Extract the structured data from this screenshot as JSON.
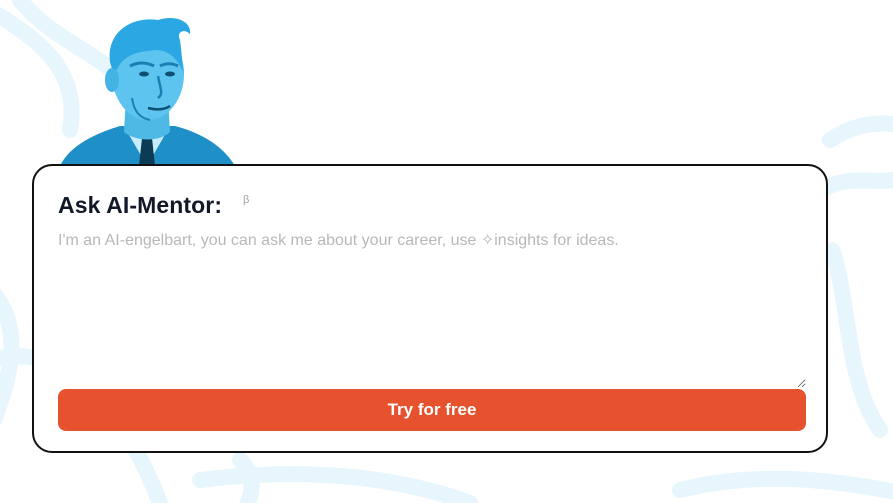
{
  "mentor": {
    "title": "Ask AI-Mentor:",
    "beta_mark": "β",
    "placeholder": "I'm an AI-engelbart, you can ask me about your career, use ✧insights for ideas.",
    "input_value": "",
    "cta_label": "Try for free"
  },
  "colors": {
    "accent": "#e5522d",
    "portrait": "#29a8e0",
    "background_swirl": "#e6f6fc",
    "card_border": "#111111"
  }
}
